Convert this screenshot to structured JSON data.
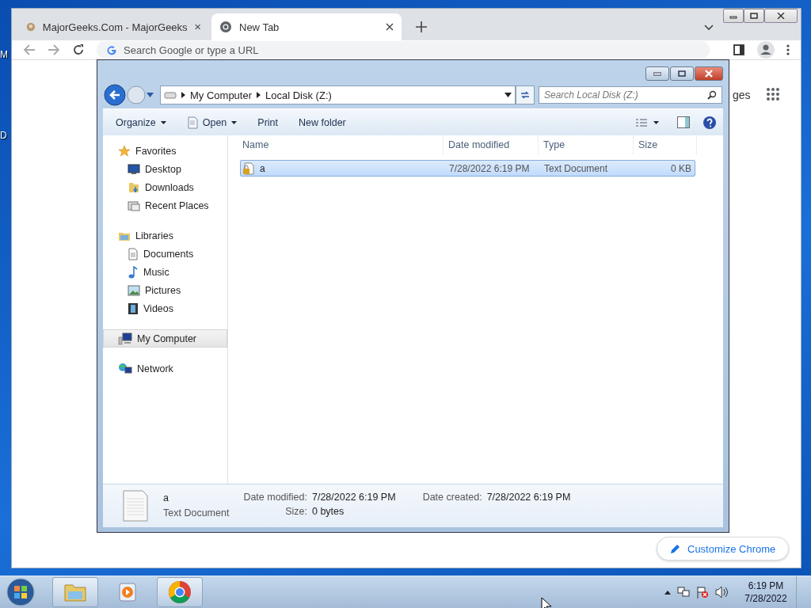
{
  "desktop": {
    "icon_labels": [
      "M",
      "D"
    ]
  },
  "chrome": {
    "tabs": [
      {
        "title": "MajorGeeks.Com - MajorGeeks",
        "selected": false
      },
      {
        "title": "New Tab",
        "selected": true
      }
    ],
    "omnibox": {
      "placeholder": "Search Google or type a URL"
    },
    "shortcut_label": "ges",
    "customize_button": "Customize Chrome"
  },
  "explorer": {
    "breadcrumb": [
      "My Computer",
      "Local Disk (Z:)"
    ],
    "search": {
      "placeholder": "Search Local Disk (Z:)"
    },
    "commands": [
      {
        "label": "Organize",
        "kind": "menu"
      },
      {
        "label": "Open",
        "kind": "icon-menu"
      },
      {
        "label": "Print",
        "kind": "plain"
      },
      {
        "label": "New folder",
        "kind": "plain"
      }
    ],
    "nav": [
      {
        "label": "Favorites",
        "selected": false,
        "children": [
          {
            "label": "Desktop",
            "selected": false
          },
          {
            "label": "Downloads",
            "selected": false
          },
          {
            "label": "Recent Places",
            "selected": false
          }
        ]
      },
      {
        "label": "Libraries",
        "selected": false,
        "children": [
          {
            "label": "Documents",
            "selected": false
          },
          {
            "label": "Music",
            "selected": false
          },
          {
            "label": "Pictures",
            "selected": false
          },
          {
            "label": "Videos",
            "selected": false
          }
        ]
      },
      {
        "label": "My Computer",
        "selected": true
      },
      {
        "label": "Network",
        "selected": false
      }
    ],
    "columns": [
      "Name",
      "Date modified",
      "Type",
      "Size"
    ],
    "files": [
      {
        "name": "a",
        "date_modified": "7/28/2022 6:19 PM",
        "type": "Text Document",
        "size": "0 KB",
        "selected": true
      }
    ],
    "details": {
      "name": "a",
      "type": "Text Document",
      "fields": [
        {
          "label": "Date modified:",
          "value": "7/28/2022 6:19 PM"
        },
        {
          "label": "Size:",
          "value": "0 bytes"
        },
        {
          "label": "Date created:",
          "value": "7/28/2022 6:19 PM"
        }
      ]
    }
  },
  "taskbar": {
    "apps": [
      {
        "kind": "explorer",
        "selected": true
      },
      {
        "kind": "media",
        "selected": false
      },
      {
        "kind": "chrome",
        "selected": true
      }
    ],
    "time": "6:19 PM",
    "date": "7/28/2022"
  }
}
